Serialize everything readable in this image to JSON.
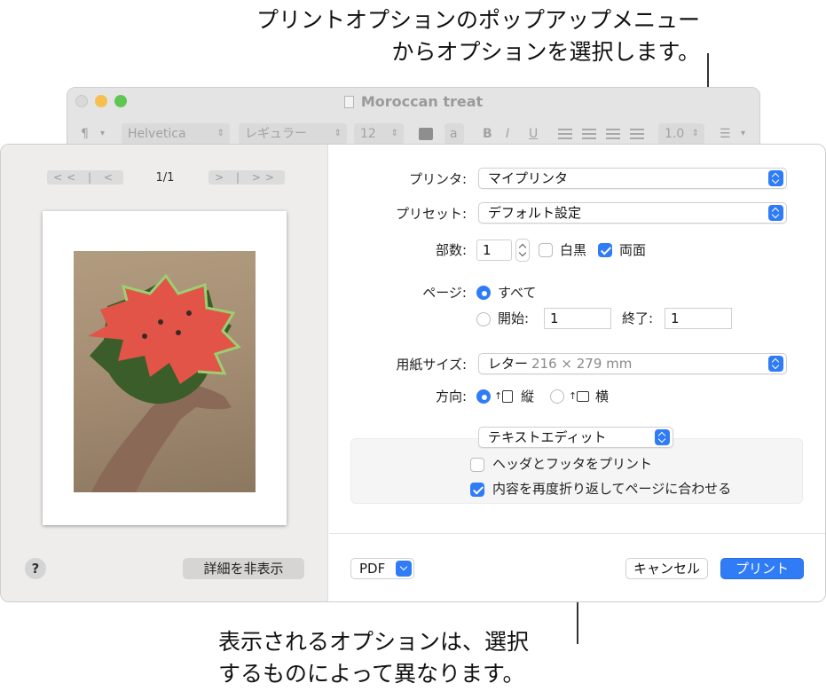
{
  "callouts": {
    "top_line1": "プリントオプションのポップアップメニュー",
    "top_line2": "からオプションを選択します。",
    "bottom_line1": "表示されるオプションは、選択",
    "bottom_line2": "するものによって異なります。"
  },
  "background_window": {
    "title": "Moroccan treat",
    "toolbar": {
      "paragraph_style": "¶",
      "font_family": "Helvetica",
      "font_style": "レギュラー",
      "font_size": "12",
      "bold": "B",
      "italic": "I",
      "underline": "U",
      "line_spacing": "1.0",
      "strike_icon_glyph": "a"
    }
  },
  "preview": {
    "page_count": "1/1",
    "first_prev_glyph": "<< | <",
    "next_last_glyph": "> | >>",
    "help_label": "?",
    "hide_details_label": "詳細を非表示"
  },
  "settings": {
    "printer_label": "プリンタ:",
    "printer_value": "マイプリンタ",
    "preset_label": "プリセット:",
    "preset_value": "デフォルト設定",
    "copies_label": "部数:",
    "copies_value": "1",
    "bw_label": "白黒",
    "bw_checked": false,
    "duplex_label": "両面",
    "duplex_checked": true,
    "pages_label": "ページ:",
    "pages_all_label": "すべて",
    "pages_from_label": "開始:",
    "pages_from_value": "1",
    "pages_to_label": "終了:",
    "pages_to_value": "1",
    "paper_size_label": "用紙サイズ:",
    "paper_size_value": "レター",
    "paper_size_dims": "216 × 279 mm",
    "orientation_label": "方向:",
    "orientation_portrait": "縦",
    "orientation_landscape": "横",
    "options_menu_value": "テキストエディット",
    "header_footer_label": "ヘッダとフッタをプリント",
    "header_footer_checked": false,
    "rewrap_label": "内容を再度折り返してページに合わせる",
    "rewrap_checked": true,
    "pdf_label": "PDF",
    "cancel_label": "キャンセル",
    "print_label": "プリント"
  },
  "colors": {
    "accent": "#2f7cf6",
    "sidebar_bg": "#efedeb"
  }
}
